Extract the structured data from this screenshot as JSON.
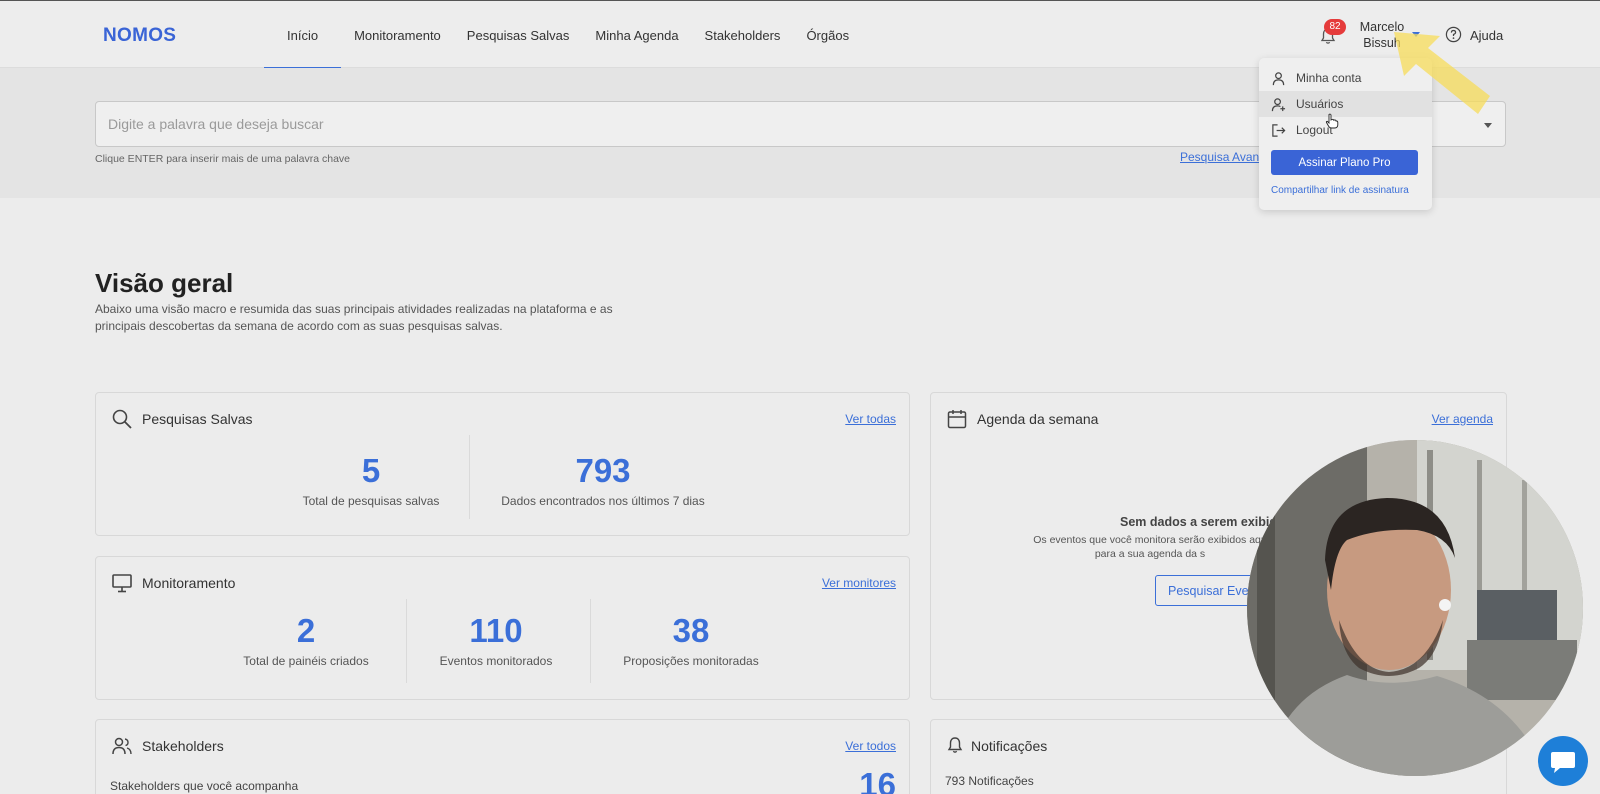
{
  "app": {
    "logo": "NOMOS"
  },
  "nav": {
    "items": [
      {
        "label": "Início",
        "active": true
      },
      {
        "label": "Monitoramento"
      },
      {
        "label": "Pesquisas Salvas"
      },
      {
        "label": "Minha Agenda"
      },
      {
        "label": "Stakeholders"
      },
      {
        "label": "Órgãos"
      }
    ]
  },
  "header": {
    "notifications_badge": "82",
    "user_first": "Marcelo",
    "user_last": "Bissuh",
    "help_label": "Ajuda"
  },
  "search": {
    "placeholder": "Digite a palavra que deseja buscar",
    "hint": "Clique ENTER para inserir mais de uma palavra chave",
    "advanced_link": "Pesquisa Avan"
  },
  "overview": {
    "title": "Visão geral",
    "description": "Abaixo uma visão macro e resumida das suas principais atividades realizadas na plataforma e as principais descobertas da semana de acordo com as suas pesquisas salvas."
  },
  "saved_searches": {
    "title": "Pesquisas Salvas",
    "link": "Ver todas",
    "stats": [
      {
        "value": "5",
        "label": "Total de pesquisas salvas"
      },
      {
        "value": "793",
        "label": "Dados encontrados nos últimos 7 dias"
      }
    ]
  },
  "monitoring": {
    "title": "Monitoramento",
    "link": "Ver monitores",
    "stats": [
      {
        "value": "2",
        "label": "Total de painéis criados"
      },
      {
        "value": "110",
        "label": "Eventos monitorados"
      },
      {
        "value": "38",
        "label": "Proposições monitoradas"
      }
    ]
  },
  "agenda": {
    "title": "Agenda da semana",
    "link": "Ver agenda",
    "empty_title": "Sem dados a serem exibido",
    "empty_line1": "Os eventos que você monitora serão exibidos aqu",
    "empty_line2": "para a sua agenda da s",
    "button": "Pesquisar Even"
  },
  "stakeholders": {
    "title": "Stakeholders",
    "link": "Ver todos",
    "subtitle": "Stakeholders que você acompanha",
    "value": "16"
  },
  "notifications": {
    "title": "Notificações",
    "count": "793 Notificações"
  },
  "user_menu": {
    "items": [
      {
        "label": "Minha conta",
        "icon": "user-icon"
      },
      {
        "label": "Usuários",
        "icon": "user-plus-icon"
      },
      {
        "label": "Logout",
        "icon": "logout-icon"
      }
    ],
    "pro_button": "Assinar Plano Pro",
    "share_link": "Compartilhar link de assinatura"
  },
  "colors": {
    "accent": "#3b6fd8",
    "brand": "#3a64d6",
    "badge": "#e53b3b",
    "highlight": "#f7dc5a"
  }
}
